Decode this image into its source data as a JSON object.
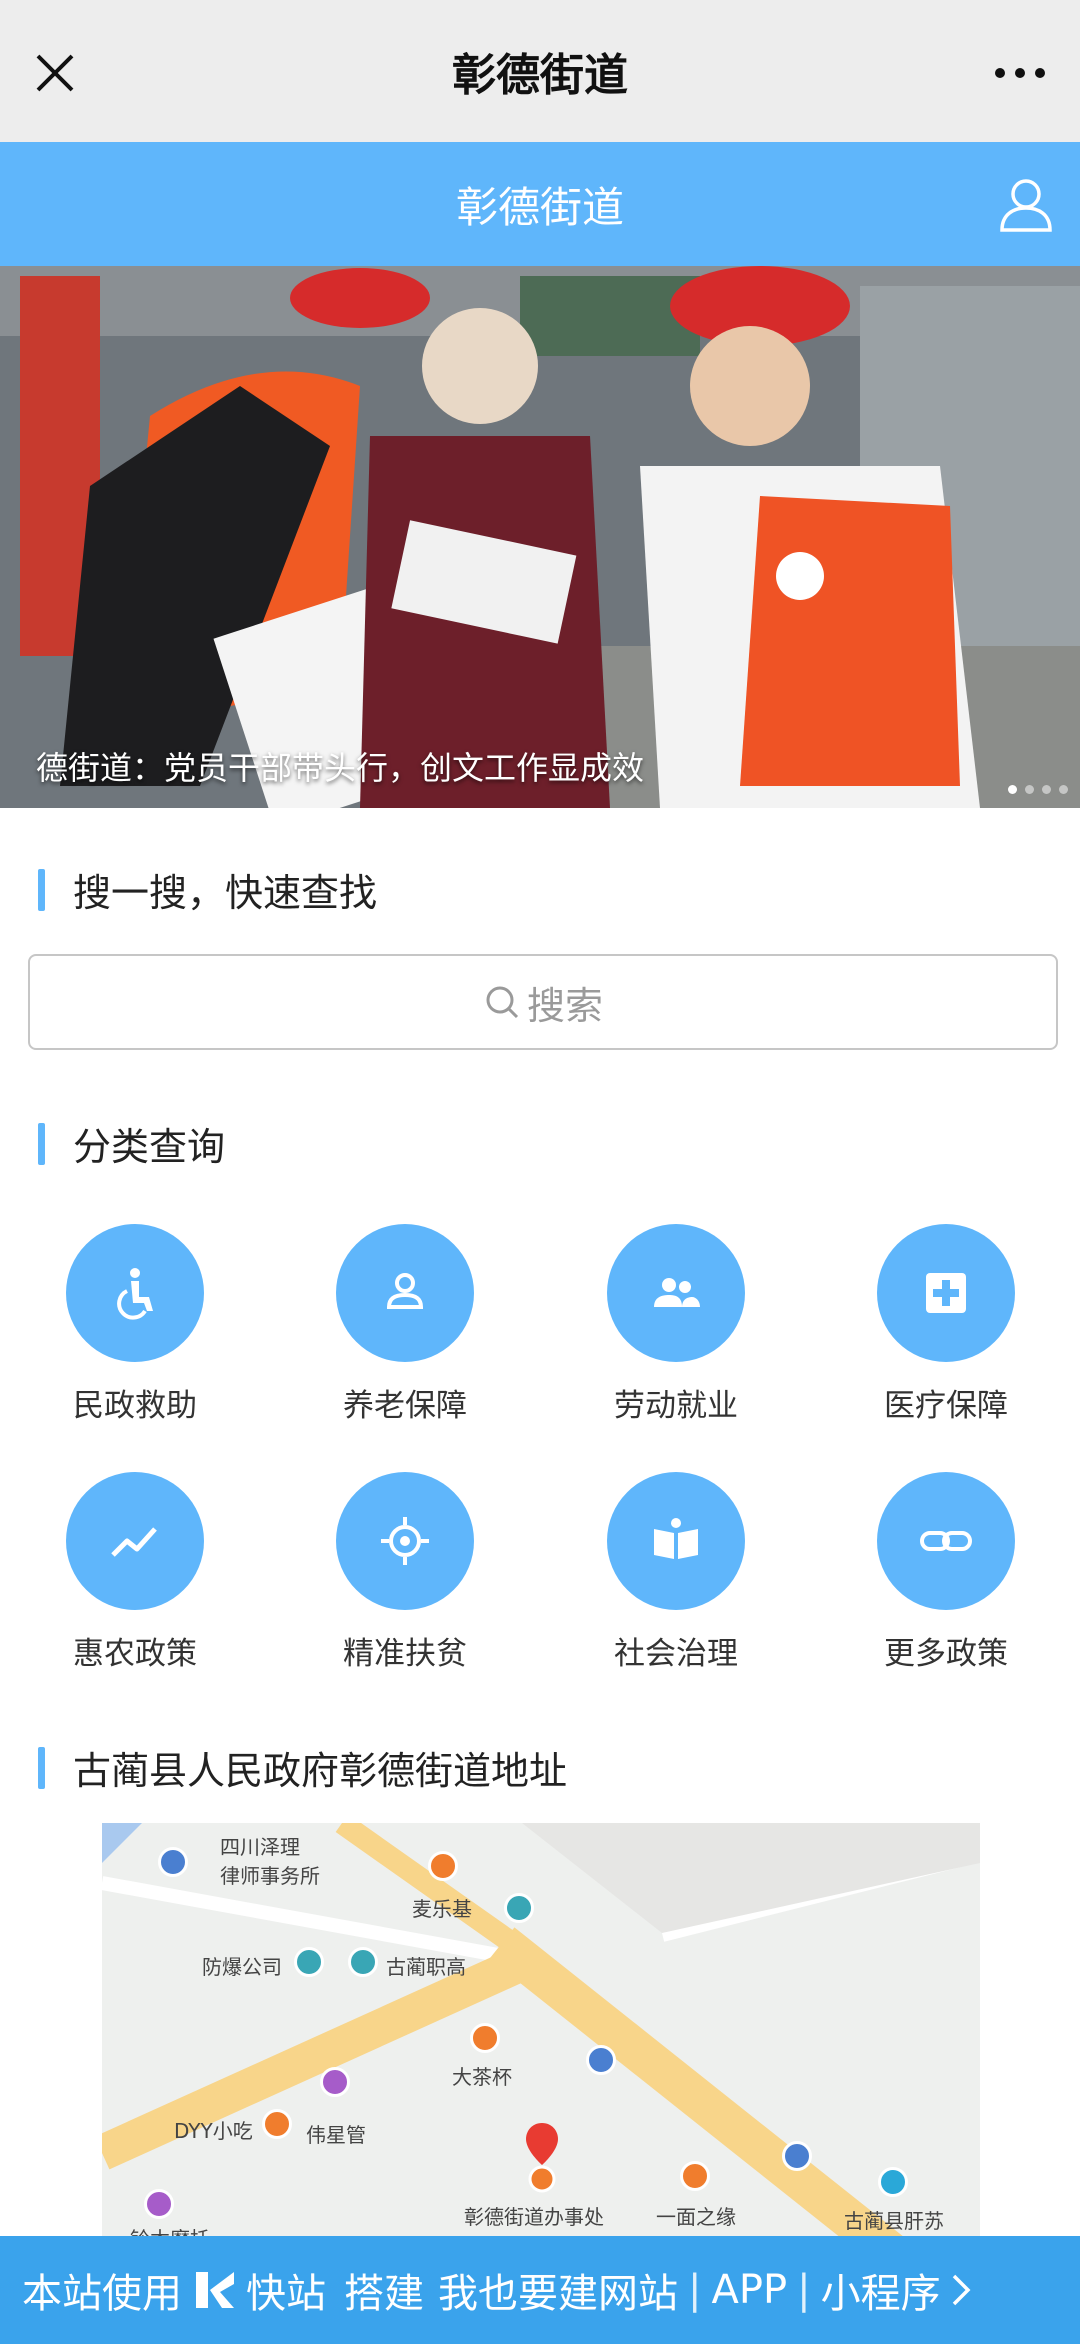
{
  "nav": {
    "title": "彰德街道"
  },
  "header": {
    "title": "彰德街道"
  },
  "banner": {
    "caption": "德街道：党员干部带头行，创文工作显成效"
  },
  "search": {
    "section_title": "搜一搜，快速查找",
    "placeholder": "搜索"
  },
  "categories": {
    "section_title": "分类查询",
    "items": [
      {
        "label": "民政救助",
        "icon": "wheelchair-icon"
      },
      {
        "label": "养老保障",
        "icon": "person-icon"
      },
      {
        "label": "劳动就业",
        "icon": "people-icon"
      },
      {
        "label": "医疗保障",
        "icon": "medical-cross-icon"
      },
      {
        "label": "惠农政策",
        "icon": "trend-icon"
      },
      {
        "label": "精准扶贫",
        "icon": "target-icon"
      },
      {
        "label": "社会治理",
        "icon": "book-icon"
      },
      {
        "label": "更多政策",
        "icon": "link-icon"
      }
    ]
  },
  "address": {
    "section_title": "古蔺县人民政府彰德街道地址",
    "pois": [
      "四川泽理\n律师事务所",
      "麦乐基",
      "防爆公司",
      "古蔺职高",
      "大茶杯",
      "DYY小吃",
      "伟星管",
      "彰德街道办事处",
      "一面之缘",
      "古蔺县肝苏",
      "铃木摩托"
    ]
  },
  "footer": {
    "prefix": "本站使用",
    "brand": "快站",
    "text1": "搭建",
    "text2": "我也要建网站",
    "app": "APP",
    "mini": "小程序"
  },
  "colors": {
    "accent": "#5fb6fb",
    "footer": "#3aa3ec"
  }
}
